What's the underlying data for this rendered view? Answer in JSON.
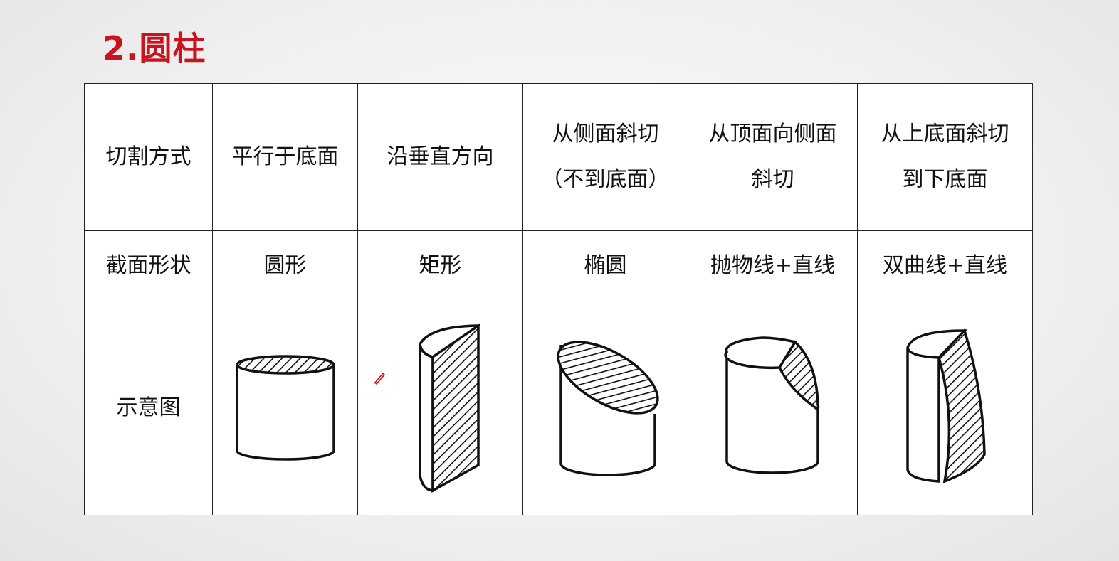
{
  "title": "2.圆柱",
  "headers": {
    "label": "切割方式",
    "col1": [
      "平行于底面"
    ],
    "col2": [
      "沿垂直方向"
    ],
    "col3": [
      "从侧面斜切",
      "（不到底面）"
    ],
    "col4": [
      "从顶面向侧面",
      "斜切"
    ],
    "col5": [
      "从上底面斜切",
      "到下底面"
    ]
  },
  "shapes": {
    "label": "截面形状",
    "values": [
      "圆形",
      "矩形",
      "椭圆",
      "抛物线+直线",
      "双曲线+直线"
    ]
  },
  "diagrams": {
    "label": "示意图",
    "icons": [
      "cylinder-horizontal-cut",
      "cylinder-vertical-cut",
      "cylinder-oblique-cut",
      "cylinder-top-to-side-cut",
      "cylinder-top-to-bottom-cut"
    ]
  },
  "colors": {
    "title": "#c8141e",
    "border": "#222222",
    "cursor": "#c8141e"
  }
}
